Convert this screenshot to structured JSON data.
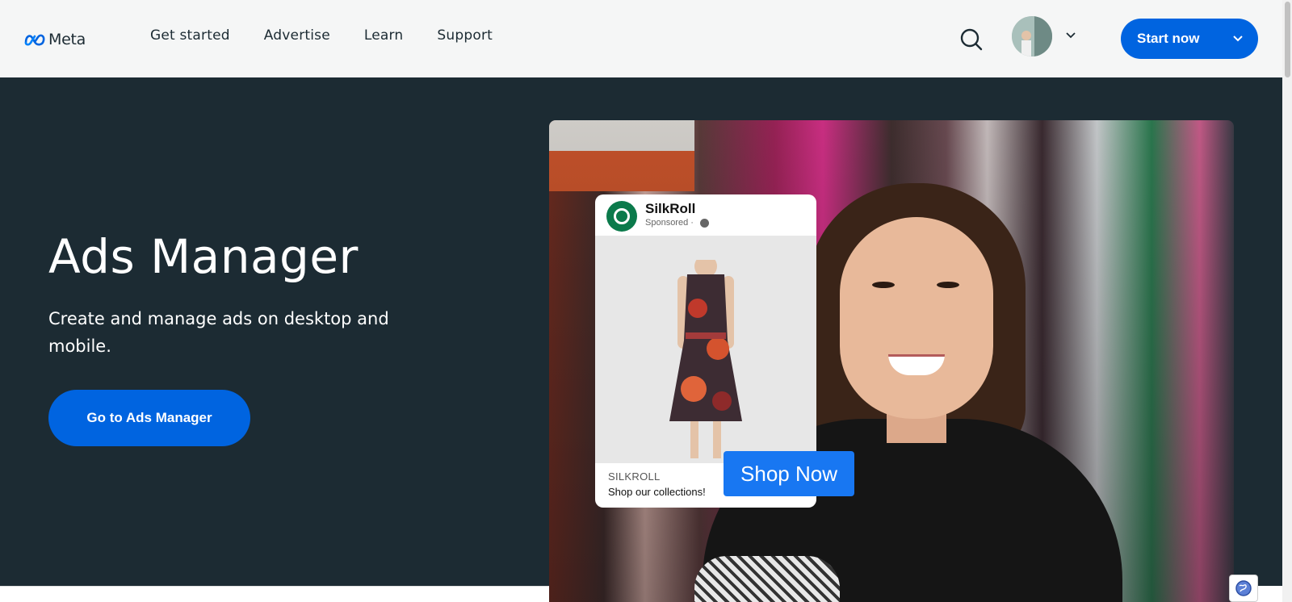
{
  "header": {
    "logo_text": "Meta",
    "nav": [
      "Get started",
      "Advertise",
      "Learn",
      "Support"
    ],
    "start_button": "Start now",
    "icons": [
      "meta-logo-icon",
      "search-icon",
      "avatar",
      "chevron-down-icon"
    ]
  },
  "hero": {
    "title": "Ads Manager",
    "subtitle": "Create and manage ads on desktop and mobile.",
    "cta": "Go to Ads Manager"
  },
  "ad": {
    "name": "SilkRoll",
    "sponsored": "Sponsored · ",
    "brand": "SILKROLL",
    "tagline": "Shop our collections!",
    "cta": "Shop Now"
  },
  "colors": {
    "brand_blue": "#0064e0",
    "hero_bg": "#1c2b33",
    "header_bg": "#f5f6f6",
    "shop_blue": "#1877f2"
  }
}
